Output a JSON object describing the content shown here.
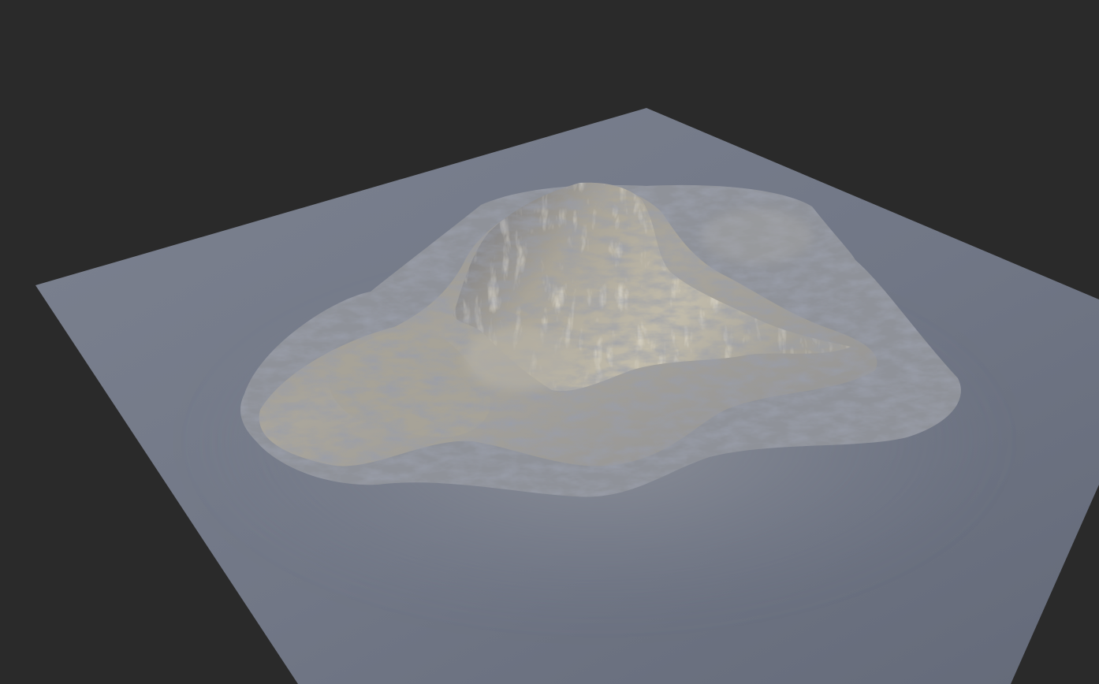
{
  "scene": {
    "subject": "terrain-heightmap-render",
    "colors": {
      "background": "#2a2a2a",
      "plane_light": "#7a808e",
      "plane_mid": "#6f7584",
      "plane_dark": "#5f6574",
      "rock_highlight": "#b9b3a4",
      "rock_mid": "#9c9a94",
      "rock_shadow": "#595d6b"
    },
    "icons": []
  }
}
